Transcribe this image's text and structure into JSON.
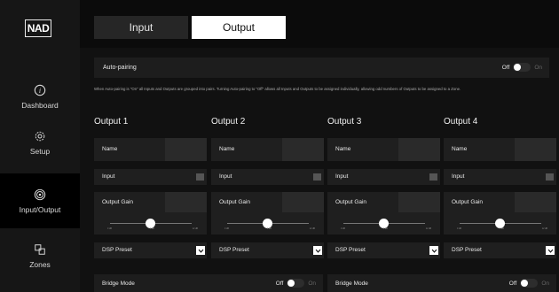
{
  "brand": {
    "logo_text": "NAD"
  },
  "sidebar": {
    "items": [
      {
        "label": "Dashboard",
        "icon": "info-icon",
        "active": false
      },
      {
        "label": "Setup",
        "icon": "gear-icon",
        "active": false
      },
      {
        "label": "Input/Output",
        "icon": "broadcast-icon",
        "active": true
      },
      {
        "label": "Zones",
        "icon": "zones-icon",
        "active": false
      }
    ]
  },
  "tabs": [
    {
      "label": "Input",
      "active": false
    },
    {
      "label": "Output",
      "active": true
    }
  ],
  "autopairing": {
    "label": "Auto-pairing",
    "off_label": "Off",
    "on_label": "On",
    "state": "off",
    "hint": "When Auto-pairing is \"On\" all Inputs and Outputs are grouped into pairs. Turning Auto-pairing to \"Off\" allows all Inputs and Outputs to be assigned individually, allowing odd numbers of Outputs to be assigned to a Zone."
  },
  "outputs": [
    {
      "title": "Output 1",
      "name_label": "Name",
      "input_label": "Input",
      "gain_label": "Output Gain",
      "dsp_label": "DSP Preset",
      "ticks": [
        "0 dB",
        "6 dB",
        "12 dB"
      ]
    },
    {
      "title": "Output 2",
      "name_label": "Name",
      "input_label": "Input",
      "gain_label": "Output Gain",
      "dsp_label": "DSP Preset",
      "ticks": [
        "0 dB",
        "6 dB",
        "12 dB"
      ]
    },
    {
      "title": "Output 3",
      "name_label": "Name",
      "input_label": "Input",
      "gain_label": "Output Gain",
      "dsp_label": "DSP Preset",
      "ticks": [
        "0 dB",
        "6 dB",
        "12 dB"
      ]
    },
    {
      "title": "Output 4",
      "name_label": "Name",
      "input_label": "Input",
      "gain_label": "Output Gain",
      "dsp_label": "DSP Preset",
      "ticks": [
        "0 dB",
        "6 dB",
        "12 dB"
      ]
    }
  ],
  "bridge": [
    {
      "label": "Bridge Mode",
      "off_label": "Off",
      "on_label": "On",
      "state": "off"
    },
    {
      "label": "Bridge Mode",
      "off_label": "Off",
      "on_label": "On",
      "state": "off"
    }
  ],
  "colors": {
    "active_tab": "#ffffff",
    "background": "#0b0b0b",
    "panel": "#1f1f1f"
  }
}
